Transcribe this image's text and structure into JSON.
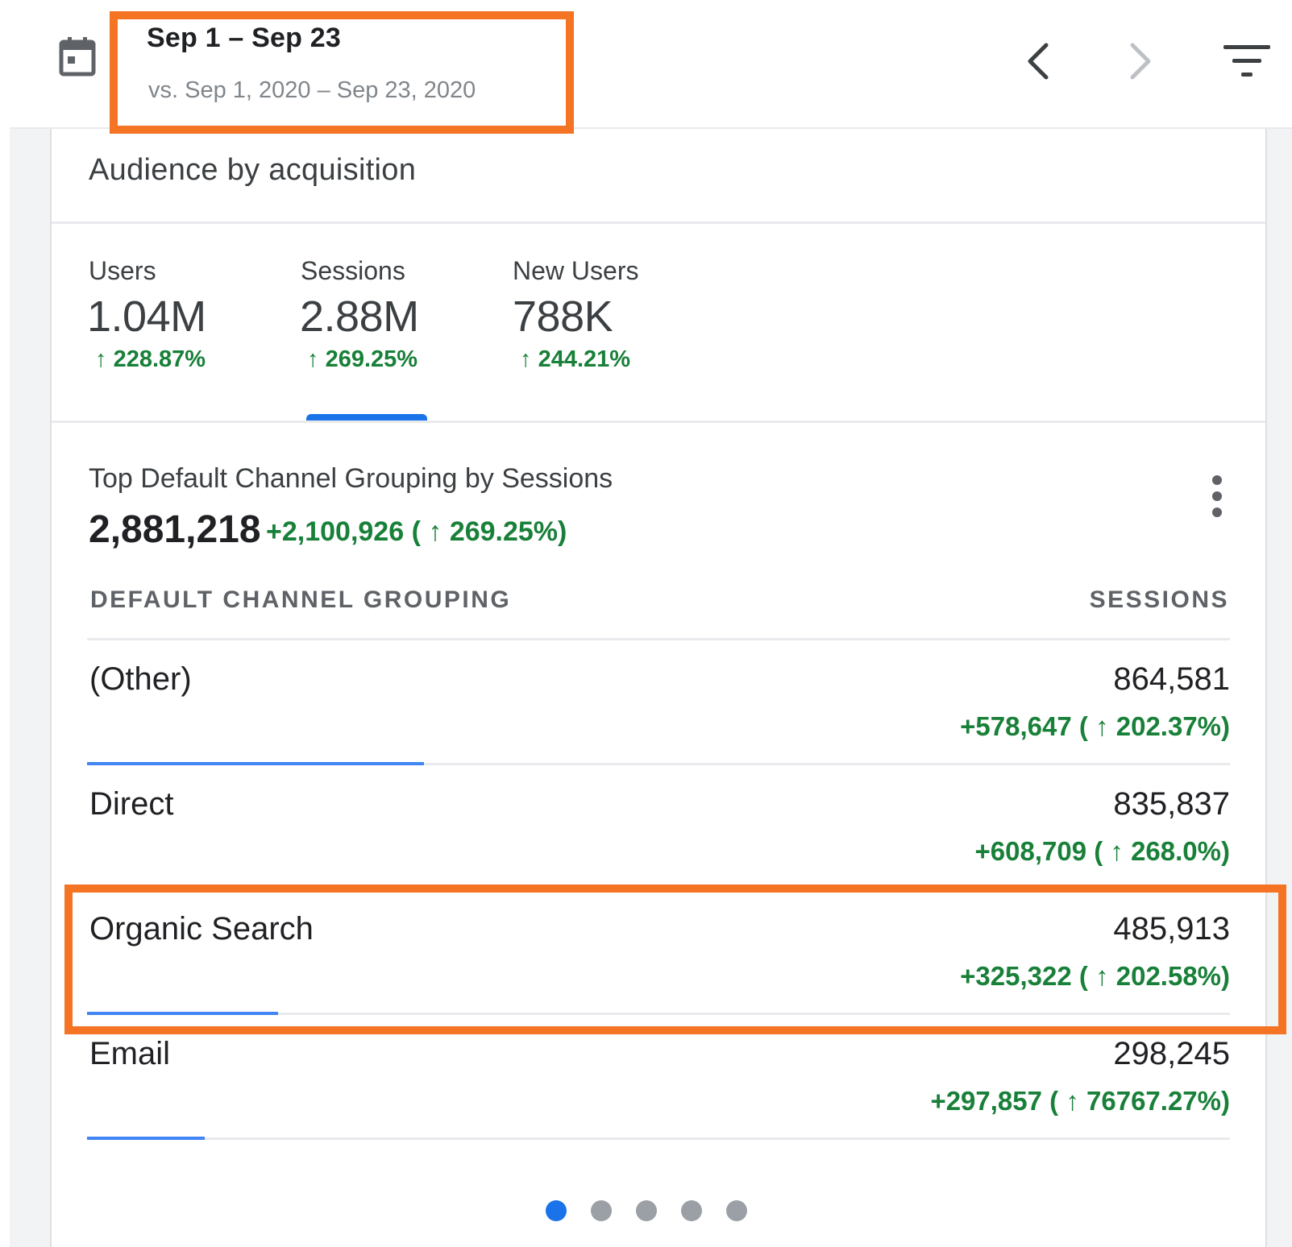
{
  "header": {
    "date_range": "Sep 1 – Sep 23",
    "compare_range": "vs. Sep 1, 2020 – Sep 23, 2020"
  },
  "card": {
    "title": "Audience by acquisition"
  },
  "metrics": [
    {
      "label": "Users",
      "value": "1.04M",
      "change": "228.87%"
    },
    {
      "label": "Sessions",
      "value": "2.88M",
      "change": "269.25%",
      "selected": true
    },
    {
      "label": "New Users",
      "value": "788K",
      "change": "244.21%"
    }
  ],
  "section": {
    "title": "Top Default Channel Grouping by Sessions",
    "total": "2,881,218",
    "total_change_abs": "+2,100,926",
    "total_change_pct": "269.25%)"
  },
  "table": {
    "columns": [
      "DEFAULT CHANNEL GROUPING",
      "SESSIONS"
    ],
    "rows": [
      {
        "name": "(Other)",
        "value": "864,581",
        "change_abs": "+578,647",
        "change_pct": "202.37%)",
        "bar_fraction": 0.295
      },
      {
        "name": "Direct",
        "value": "835,837",
        "change_abs": "+608,709",
        "change_pct": "268.0%)",
        "bar_fraction": 0
      },
      {
        "name": "Organic Search",
        "value": "485,913",
        "change_abs": "+325,322",
        "change_pct": "202.58%)",
        "bar_fraction": 0.167
      },
      {
        "name": "Email",
        "value": "298,245",
        "change_abs": "+297,857",
        "change_pct": "76767.27%)",
        "bar_fraction": 0.103
      }
    ]
  },
  "pager": {
    "count": 5,
    "active_index": 0
  },
  "colors": {
    "accent": "#1a73e8",
    "positive": "#188038",
    "highlight": "#f47424"
  },
  "icons": [
    "calendar-icon",
    "chevron-left-icon",
    "chevron-right-icon",
    "filter-icon",
    "more-vert-icon",
    "arrow-up-icon"
  ]
}
